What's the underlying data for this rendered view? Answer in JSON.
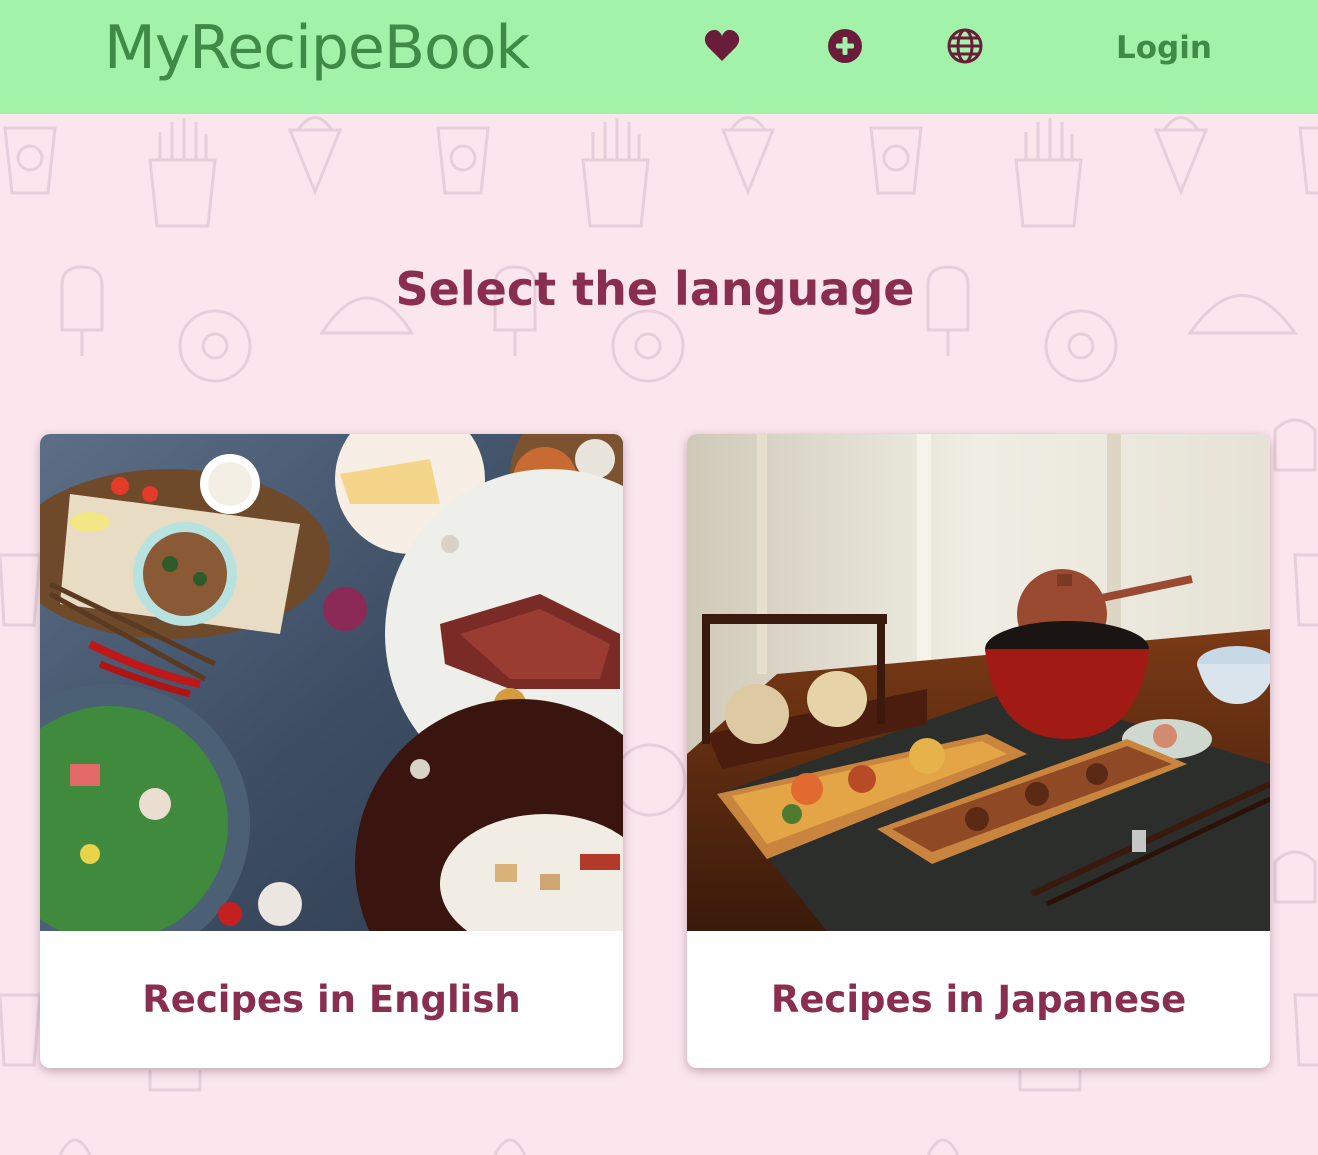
{
  "navbar": {
    "brand": "MyRecipeBook",
    "icons": [
      "heart-icon",
      "plus-circle-icon",
      "globe-icon"
    ],
    "login_label": "Login",
    "icon_color": "#6a1d3a",
    "background": "#a2f2aa",
    "text_color": "#3f8a46"
  },
  "main": {
    "heading": "Select the language",
    "heading_color": "#8a2e4f",
    "cards": [
      {
        "title": "Recipes in English"
      },
      {
        "title": "Recipes in Japanese"
      }
    ]
  },
  "page": {
    "background": "#fce6ee"
  }
}
